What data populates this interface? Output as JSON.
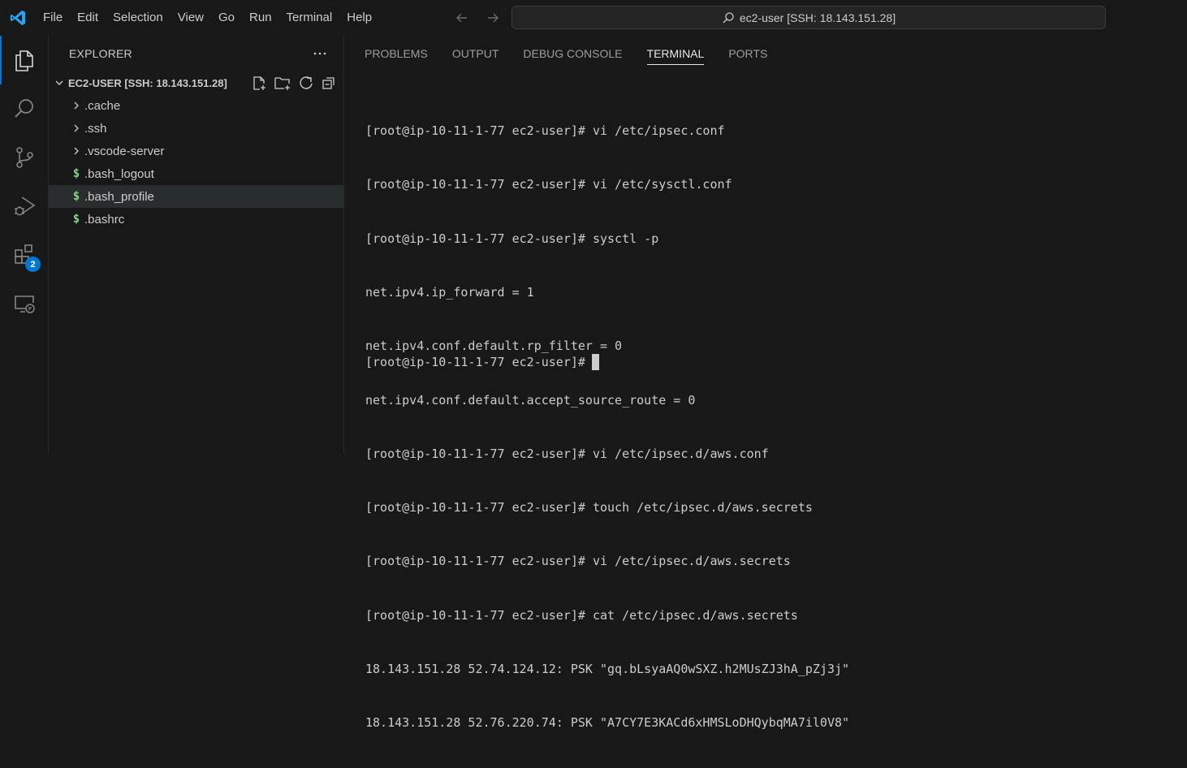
{
  "titlebar": {
    "app_icon": "vscode-logo",
    "menu": [
      "File",
      "Edit",
      "Selection",
      "View",
      "Go",
      "Run",
      "Terminal",
      "Help"
    ],
    "command_center": "ec2-user [SSH: 18.143.151.28]"
  },
  "activitybar": {
    "items": [
      "explorer-icon",
      "search-icon",
      "source-control-icon",
      "run-debug-icon",
      "extensions-icon",
      "remote-explorer-icon"
    ],
    "extensions_badge": "2"
  },
  "sidebar": {
    "title": "EXPLORER",
    "folder": "EC2-USER [SSH: 18.143.151.28]",
    "items": [
      {
        "label": ".cache",
        "type": "folder"
      },
      {
        "label": ".ssh",
        "type": "folder"
      },
      {
        "label": ".vscode-server",
        "type": "folder"
      },
      {
        "label": ".bash_logout",
        "type": "file"
      },
      {
        "label": ".bash_profile",
        "type": "file"
      },
      {
        "label": ".bashrc",
        "type": "file"
      }
    ]
  },
  "panel": {
    "tabs": [
      "PROBLEMS",
      "OUTPUT",
      "DEBUG CONSOLE",
      "TERMINAL",
      "PORTS"
    ],
    "active_tab": "TERMINAL",
    "terminal_lines": [
      "[root@ip-10-11-1-77 ec2-user]# vi /etc/ipsec.conf",
      "[root@ip-10-11-1-77 ec2-user]# vi /etc/sysctl.conf",
      "[root@ip-10-11-1-77 ec2-user]# sysctl -p",
      "net.ipv4.ip_forward = 1",
      "net.ipv4.conf.default.rp_filter = 0",
      "net.ipv4.conf.default.accept_source_route = 0",
      "[root@ip-10-11-1-77 ec2-user]# vi /etc/ipsec.d/aws.conf",
      "[root@ip-10-11-1-77 ec2-user]# touch /etc/ipsec.d/aws.secrets",
      "[root@ip-10-11-1-77 ec2-user]# vi /etc/ipsec.d/aws.secrets",
      "[root@ip-10-11-1-77 ec2-user]# cat /etc/ipsec.d/aws.secrets",
      "18.143.151.28 52.74.124.12: PSK \"gq.bLsyaAQ0wSXZ.h2MUsZJ3hA_pZj3j\"",
      "18.143.151.28 52.76.220.74: PSK \"A7CY7E3KACd6xHMSLoDHQybqMA7il0V8\""
    ],
    "current_prompt": "[root@ip-10-11-1-77 ec2-user]#"
  },
  "colors": {
    "accent": "#0078d4",
    "shell_icon": "#89d185",
    "background": "#181818"
  }
}
